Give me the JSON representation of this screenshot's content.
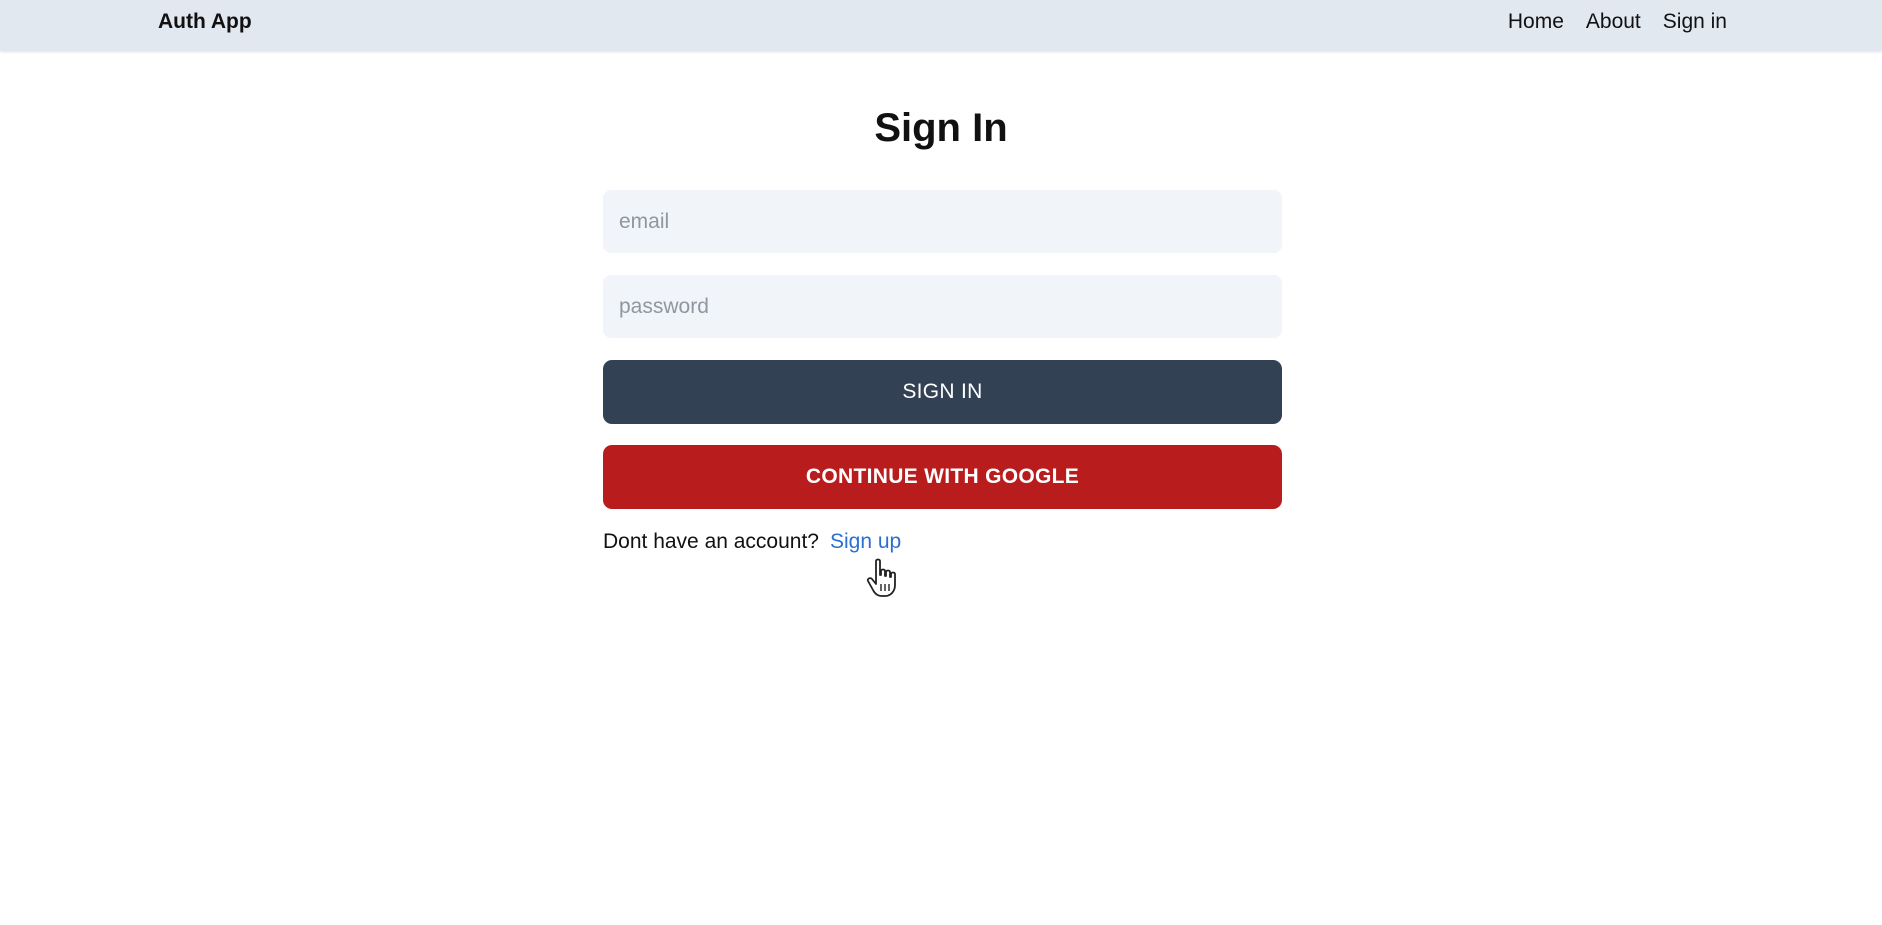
{
  "navbar": {
    "brand": "Auth App",
    "links": [
      "Home",
      "About",
      "Sign in"
    ]
  },
  "page": {
    "title": "Sign In"
  },
  "form": {
    "email_placeholder": "email",
    "password_placeholder": "password",
    "signin_label": "SIGN IN",
    "google_label": "CONTINUE WITH GOOGLE"
  },
  "signup": {
    "prompt": "Dont have an account?",
    "link": "Sign up"
  },
  "colors": {
    "navbar_bg": "#e2e8f0",
    "signin_button": "#334155",
    "google_button": "#b91c1c",
    "link": "#2b6fd1",
    "input_bg": "#f1f5f9"
  },
  "icons": {
    "cursor": "hand-pointer-icon"
  }
}
